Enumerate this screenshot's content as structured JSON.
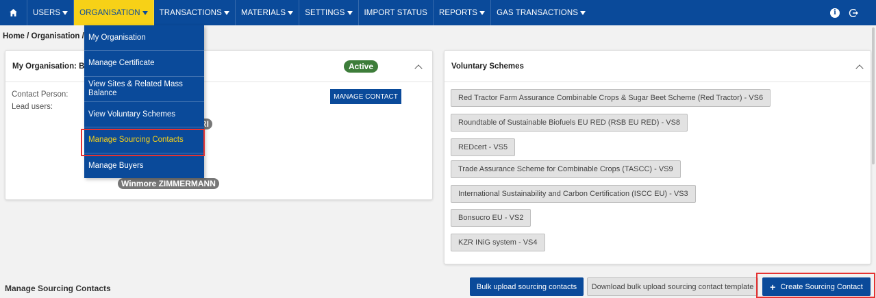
{
  "nav": {
    "items": [
      {
        "label": "USERS",
        "caret": true
      },
      {
        "label": "ORGANISATION",
        "caret": true,
        "active": true
      },
      {
        "label": "TRANSACTIONS",
        "caret": true
      },
      {
        "label": "MATERIALS",
        "caret": true
      },
      {
        "label": "SETTINGS",
        "caret": true
      },
      {
        "label": "IMPORT STATUS",
        "caret": false
      },
      {
        "label": "REPORTS",
        "caret": true
      },
      {
        "label": "GAS TRANSACTIONS",
        "caret": true
      }
    ],
    "home_icon": "home-icon",
    "right_icons": [
      "info-icon",
      "logout-icon"
    ],
    "colors": {
      "bar": "#0a4a9a",
      "active_bg": "#f7d117"
    }
  },
  "breadcrumb": {
    "text": "Home / Organisation / M"
  },
  "organisation_card": {
    "title": "My Organisation: Bel",
    "status": "Active",
    "contact_label": "Contact Person:",
    "lead_label": "Lead users:",
    "manage_contact_label": "MANAGE CONTACT",
    "lead_users": [
      "RI",
      "Winmore ZIMMERMANN"
    ]
  },
  "dropdown": {
    "items": [
      {
        "label": "My Organisation"
      },
      {
        "label": "Manage Certificate"
      },
      {
        "label": "View Sites & Related Mass Balance"
      },
      {
        "label": "View Voluntary Schemes"
      },
      {
        "label": "Manage Sourcing Contacts",
        "highlight": true
      },
      {
        "label": "Manage Buyers"
      }
    ]
  },
  "voluntary_card": {
    "title": "Voluntary Schemes",
    "schemes": [
      "Red Tractor Farm Assurance Combinable Crops & Sugar Beet Scheme (Red Tractor) - VS6",
      "Roundtable of Sustainable Biofuels EU RED (RSB EU RED) - VS8",
      "REDcert - VS5",
      "Trade Assurance Scheme for Combinable Crops (TASCC) - VS9",
      "International Sustainability and Carbon Certification (ISCC EU) - VS3",
      "Bonsucro EU - VS2",
      "KZR INiG system - VS4"
    ]
  },
  "bottom": {
    "title": "Manage Sourcing Contacts",
    "bulk_upload_label": "Bulk upload sourcing contacts",
    "download_template_label": "Download bulk upload sourcing contact template",
    "create_label": "Create Sourcing Contact",
    "create_icon": "plus-icon"
  }
}
